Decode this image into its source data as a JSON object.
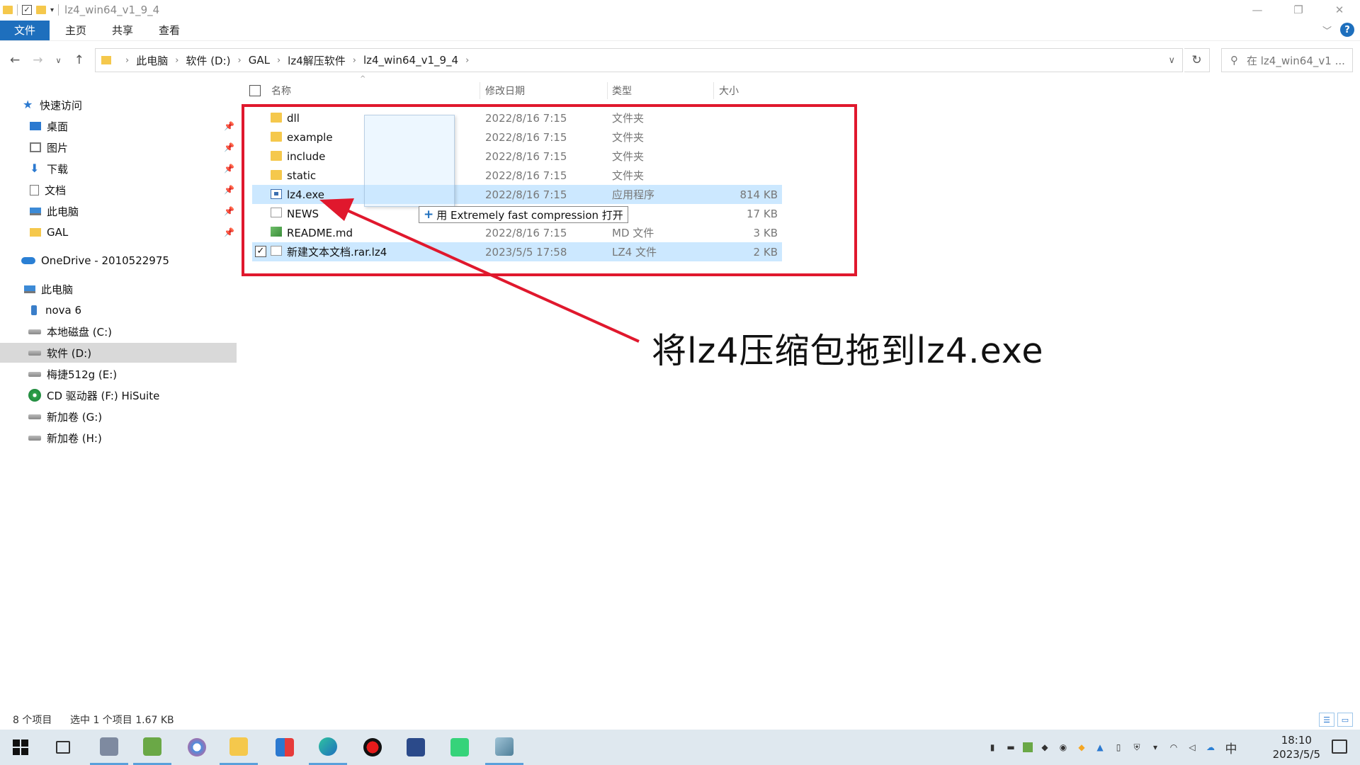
{
  "window": {
    "title": "lz4_win64_v1_9_4",
    "controls": {
      "minimize": "—",
      "maximize": "❐",
      "close": "✕"
    }
  },
  "ribbon": {
    "tabs": [
      "文件",
      "主页",
      "共享",
      "查看"
    ],
    "help": "?"
  },
  "address": {
    "crumbs": [
      "此电脑",
      "软件 (D:)",
      "GAL",
      "lz4解压软件",
      "lz4_win64_v1_9_4"
    ],
    "search_placeholder": "在 lz4_win64_v1 ..."
  },
  "sidebar": {
    "quick_access": "快速访问",
    "pinned": [
      "桌面",
      "图片",
      "下载",
      "文档",
      "此电脑",
      "GAL"
    ],
    "onedrive": "OneDrive - 2010522975",
    "this_pc": "此电脑",
    "devices": [
      "nova 6",
      "本地磁盘 (C:)",
      "软件 (D:)",
      "梅捷512g (E:)",
      "CD 驱动器 (F:) HiSuite",
      "新加卷 (G:)",
      "新加卷 (H:)"
    ]
  },
  "columns": {
    "name": "名称",
    "date": "修改日期",
    "type": "类型",
    "size": "大小"
  },
  "files": [
    {
      "name": "dll",
      "date": "2022/8/16 7:15",
      "type": "文件夹",
      "size": "",
      "icon": "folder"
    },
    {
      "name": "example",
      "date": "2022/8/16 7:15",
      "type": "文件夹",
      "size": "",
      "icon": "folder"
    },
    {
      "name": "include",
      "date": "2022/8/16 7:15",
      "type": "文件夹",
      "size": "",
      "icon": "folder"
    },
    {
      "name": "static",
      "date": "2022/8/16 7:15",
      "type": "文件夹",
      "size": "",
      "icon": "folder"
    },
    {
      "name": "lz4.exe",
      "date": "2022/8/16 7:15",
      "type": "应用程序",
      "size": "814 KB",
      "icon": "exe"
    },
    {
      "name": "NEWS",
      "date": "",
      "type": "件",
      "size": "17 KB",
      "icon": "file"
    },
    {
      "name": "README.md",
      "date": "2022/8/16 7:15",
      "type": "MD 文件",
      "size": "3 KB",
      "icon": "md"
    },
    {
      "name": "新建文本文档.rar.lz4",
      "date": "2023/5/5 17:58",
      "type": "LZ4 文件",
      "size": "2 KB",
      "icon": "file"
    }
  ],
  "drag_tooltip": {
    "text": "用 Extremely fast compression 打开",
    "plus": "+"
  },
  "annotation": {
    "text": "将lz4压缩包拖到lz4.exe",
    "color": "#e0182d"
  },
  "status": {
    "count": "8 个项目",
    "selection": "选中 1 个项目  1.67 KB"
  },
  "taskbar": {
    "ime": "中",
    "time": "18:10",
    "date": "2023/5/5"
  }
}
